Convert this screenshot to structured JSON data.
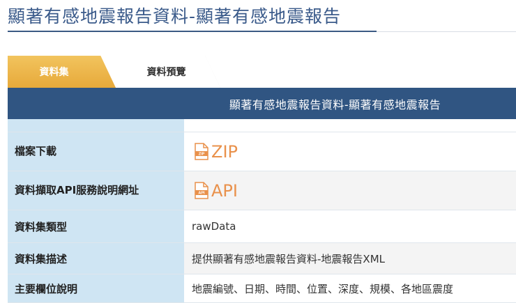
{
  "page": {
    "title": "顯著有感地震報告資料-顯著有感地震報告"
  },
  "tabs": [
    {
      "label": "資料集",
      "active": true
    },
    {
      "label": "資料預覽",
      "active": false
    }
  ],
  "table": {
    "header": "顯著有感地震報告資料-顯著有感地震報告",
    "rows": [
      {
        "label": "檔案下載",
        "value": "ZIP",
        "icon_text": "ZIP"
      },
      {
        "label": "資料擷取API服務說明網址",
        "value": "API",
        "icon_text": "API"
      },
      {
        "label": "資料集類型",
        "value": "rawData"
      },
      {
        "label": "資料集描述",
        "value": "提供顯著有感地震報告資料-地震報告XML"
      },
      {
        "label": "主要欄位說明",
        "value": "地震編號、日期、時間、位置、深度、規模、各地區震度"
      }
    ]
  },
  "icons": {
    "zip": "zip-file-icon",
    "api": "api-file-icon"
  },
  "colors": {
    "title": "#3a5a8a",
    "tab_active": "#e7a93a",
    "table_header": "#305582",
    "label_bg": "#cfe5f3",
    "link": "#e9914b"
  }
}
